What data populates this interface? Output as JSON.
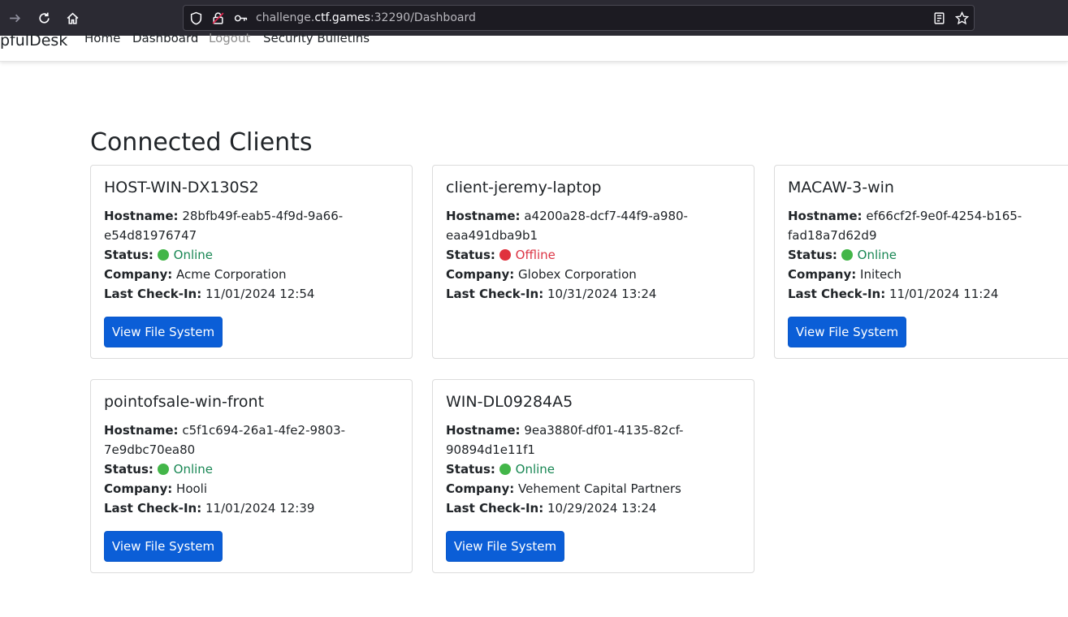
{
  "browser": {
    "url_prefix": "challenge.",
    "url_domain": "ctf.games",
    "url_suffix": ":32290/Dashboard"
  },
  "nav": {
    "brand": "pfulDesk",
    "links": [
      "Home",
      "Dashboard",
      "Logout",
      "Security Bulletins"
    ]
  },
  "page": {
    "title": "Connected Clients"
  },
  "labels": {
    "hostname": "Hostname:",
    "status": "Status:",
    "company": "Company:",
    "last_checkin": "Last Check-In:",
    "button": "View File System"
  },
  "clients": [
    {
      "name": "HOST-WIN-DX130S2",
      "hostname": "28bfb49f-eab5-4f9d-9a66-e54d81976747",
      "status": "Online",
      "company": "Acme Corporation",
      "last_checkin": "11/01/2024 12:54"
    },
    {
      "name": "client-jeremy-laptop",
      "hostname": "a4200a28-dcf7-44f9-a980-eaa491dba9b1",
      "status": "Offline",
      "company": "Globex Corporation",
      "last_checkin": "10/31/2024 13:24"
    },
    {
      "name": "MACAW-3-win",
      "hostname": "ef66cf2f-9e0f-4254-b165-fad18a7d62d9",
      "status": "Online",
      "company": "Initech",
      "last_checkin": "11/01/2024 11:24"
    },
    {
      "name": "pointofsale-win-front",
      "hostname": "c5f1c694-26a1-4fe2-9803-7e9dbc70ea80",
      "status": "Online",
      "company": "Hooli",
      "last_checkin": "11/01/2024 12:39"
    },
    {
      "name": "WIN-DL09284A5",
      "hostname": "9ea3880f-df01-4135-82cf-90894d1e11f1",
      "status": "Online",
      "company": "Vehement Capital Partners",
      "last_checkin": "10/29/2024 13:24"
    }
  ],
  "colors": {
    "online": "#198754",
    "offline": "#dc3545",
    "button": "#0b5ed7"
  },
  "icons": [
    "arrow-right-icon",
    "reload-icon",
    "home-icon",
    "shield-icon",
    "lock-icon",
    "key-icon",
    "reader-icon",
    "star-icon",
    "status-dot-icon"
  ]
}
